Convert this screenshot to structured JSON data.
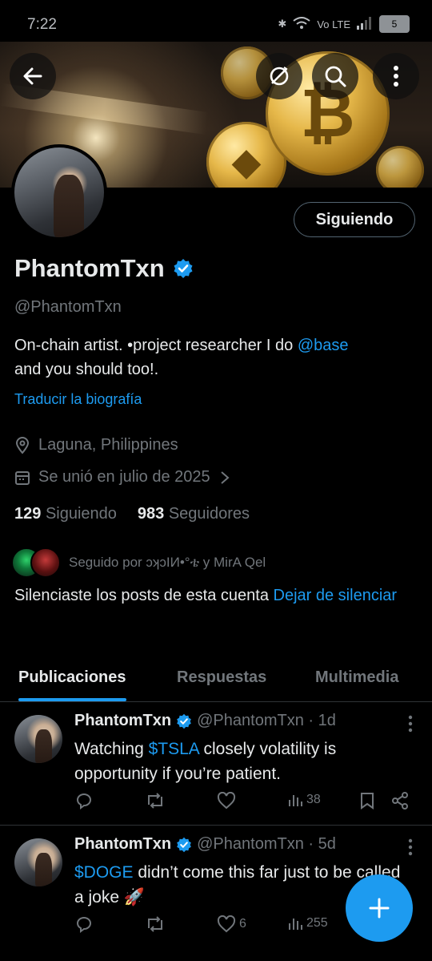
{
  "status_bar": {
    "time": "7:22",
    "network": "Vo LTE",
    "battery": "5"
  },
  "profile": {
    "display_name": "PhantomTxn",
    "handle": "@PhantomTxn",
    "bio_text": "On-chain artist. •project researcher I do ",
    "bio_mention": "@base",
    "bio_text_2": "and you should too!.",
    "translate_bio": "Traducir la biografía",
    "location": "Laguna, Philippines",
    "joined": "Se unió en julio de 2025",
    "following_count": "129",
    "following_label": "Siguiendo",
    "followers_count": "983",
    "followers_label": "Seguidores",
    "follow_button": "Siguiendo",
    "followed_by": "Seguido por ɔʞɔIИ•°ቴ y MirA Qel",
    "muted_text": "Silenciaste los posts de esta cuenta ",
    "unmute_link": "Dejar de silenciar"
  },
  "tabs": [
    "Publicaciones",
    "Respuestas",
    "Multimedia"
  ],
  "posts": [
    {
      "name": "PhantomTxn",
      "handle_time": "@PhantomTxn · 1d",
      "text_pre": "Watching ",
      "cashtag": "$TSLA",
      "text_post": " closely volatility is opportunity if you’re patient.",
      "likes": "",
      "views": "38"
    },
    {
      "name": "PhantomTxn",
      "handle_time": "@PhantomTxn · 5d",
      "text_pre": "",
      "cashtag": "$DOGE",
      "text_post": " didn’t come this far just to be called a joke 🚀",
      "likes": "6",
      "views": "255"
    }
  ],
  "colors": {
    "accent": "#1d9bf0",
    "background": "#000000",
    "muted_text": "#71767b",
    "text": "#e7e9ea"
  },
  "icons": [
    "back-arrow-icon",
    "no-repost-icon",
    "search-icon",
    "more-icon",
    "verified-badge-icon",
    "location-pin-icon",
    "calendar-icon",
    "chevron-right-icon",
    "reply-icon",
    "repost-icon",
    "like-icon",
    "views-icon",
    "bookmark-icon",
    "share-icon",
    "compose-plus-icon"
  ]
}
